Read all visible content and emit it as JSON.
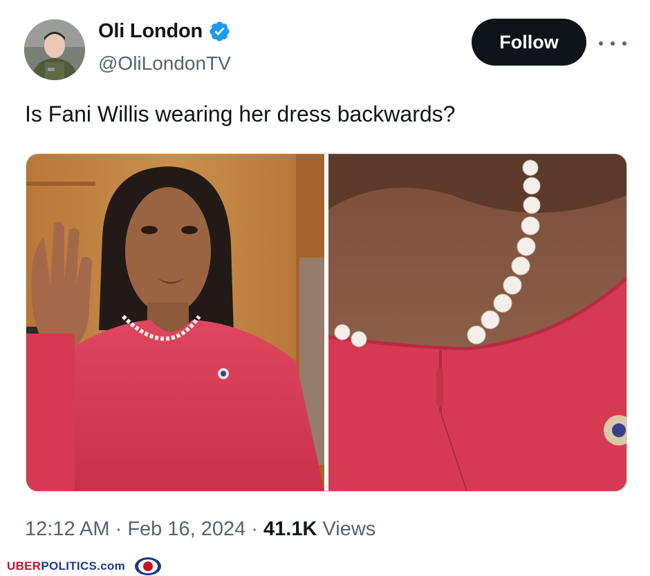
{
  "user": {
    "display_name": "Oli London",
    "handle": "@OliLondonTV",
    "verified": true,
    "avatar_icon": "profile-avatar"
  },
  "actions": {
    "follow_label": "Follow",
    "more_icon": "more-horizontal-icon"
  },
  "tweet": {
    "text": "Is Fani Willis wearing her dress backwards?",
    "media_count": 2
  },
  "meta": {
    "time": "12:12 AM",
    "separator": " · ",
    "date": "Feb 16, 2024",
    "views_count": "41.1K",
    "views_label": " Views"
  },
  "watermark": {
    "brand_first": "UBER",
    "brand_second": "POLITICS.com",
    "logo_icon": "lion-crest-logo"
  },
  "colors": {
    "text_primary": "#0f1419",
    "text_secondary": "#536471",
    "verified_blue": "#1d9bf0",
    "follow_bg": "#0f1419",
    "dress_red": "#d63a53"
  }
}
